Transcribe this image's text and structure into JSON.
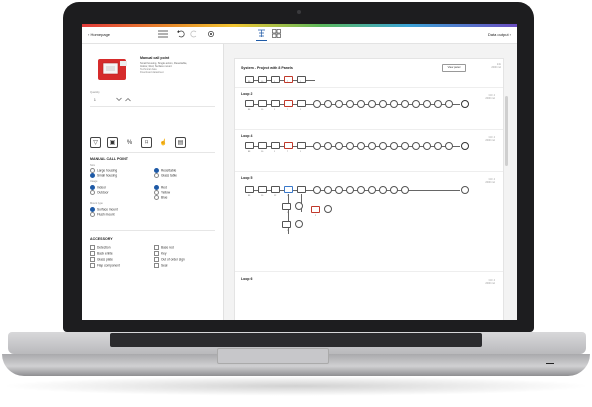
{
  "topbar": {
    "back_label": "‹ Homepage",
    "data_output_label": "Data output ›"
  },
  "product": {
    "title": "Manual call point",
    "description_lines": [
      "Small housing, Single action, Resettable,",
      "Indoor, Red, Surface mount"
    ],
    "small_link": "Technical data",
    "small_link2": "Download datasheet"
  },
  "quantity": {
    "label": "Quantity",
    "value": "1"
  },
  "manual_call_point": {
    "section_title": "MANUAL CALL POINT",
    "group1_label": "Size",
    "housing": [
      {
        "label": "Large housing",
        "selected": false
      },
      {
        "label": "Small housing",
        "selected": true
      }
    ],
    "glass": [
      {
        "label": "Resettable",
        "selected": true
      },
      {
        "label": "Glass table",
        "selected": false
      }
    ],
    "group2_label": "Usage",
    "usage": [
      {
        "label": "Indoor",
        "selected": true
      },
      {
        "label": "Outdoor",
        "selected": false
      }
    ],
    "color": [
      {
        "label": "Red",
        "selected": true
      },
      {
        "label": "Yellow",
        "selected": false
      },
      {
        "label": "Blue",
        "selected": false
      }
    ],
    "group3_label": "Mount type",
    "mount": [
      {
        "label": "Surface mount",
        "selected": true
      },
      {
        "label": "Flush mount",
        "selected": false
      }
    ]
  },
  "accessory": {
    "section_title": "ACCESSORY",
    "left": [
      "Detection",
      "Back enlite",
      "Glass plate",
      "Flap component"
    ],
    "right": [
      "Base red",
      "Key",
      "Out of order sign",
      "Seal"
    ]
  },
  "system": {
    "title": "System - Project with 8 Panels",
    "view_button": "View panel",
    "meta_lines": [
      "Info",
      "2000 mA"
    ],
    "first_row_labels": [
      "88",
      "10",
      "1",
      "7",
      "1"
    ],
    "loops": [
      {
        "name": "Loop 2",
        "labels": [
          "88",
          "10",
          "1",
          "7",
          "1"
        ],
        "meta": [
          "Ctrl: 4",
          "2000 mA"
        ]
      },
      {
        "name": "Loop 4",
        "labels": [
          "88",
          "10",
          "1",
          "7",
          "1"
        ],
        "meta": [
          "Ctrl: 4",
          "2000 mA"
        ]
      },
      {
        "name": "Loop 5",
        "labels": [
          "88",
          "10",
          "12",
          "1"
        ],
        "meta": [
          "Ctrl: 4",
          "2000 mA"
        ]
      },
      {
        "name": "Loop 6",
        "labels": [],
        "meta": [
          "Ctrl: 4",
          "2000 mA"
        ]
      }
    ],
    "branch_labels": [
      "1",
      "1",
      "2"
    ]
  },
  "colors": {
    "accent": "#1f5aa6",
    "product_red": "#d62b2b",
    "highlight_blue": "#3a78c9",
    "highlight_red": "#c0392b"
  }
}
